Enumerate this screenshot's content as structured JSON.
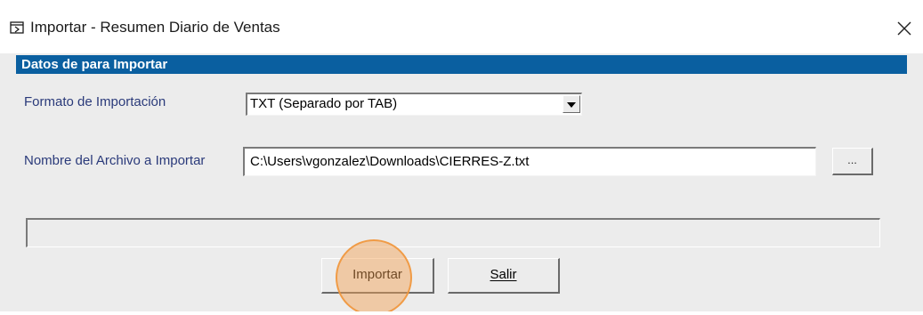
{
  "window": {
    "title": "Importar - Resumen Diario de Ventas",
    "icon": "window-app-icon",
    "close_icon": "close-icon"
  },
  "section": {
    "title": "Datos de para  Importar"
  },
  "format": {
    "label": "Formato de Importación",
    "selected": "TXT (Separado por TAB)"
  },
  "file": {
    "label": "Nombre del Archivo a Importar",
    "value": "C:\\Users\\vgonzalez\\Downloads\\CIERRES-Z.txt",
    "browse_label": "..."
  },
  "progress": {
    "value": 0
  },
  "buttons": {
    "import_label": "Importar",
    "exit_label": "Salir"
  },
  "colors": {
    "header_bg": "#0a5fa0",
    "label_text": "#2a3a7a",
    "highlight": "#f5a050"
  }
}
